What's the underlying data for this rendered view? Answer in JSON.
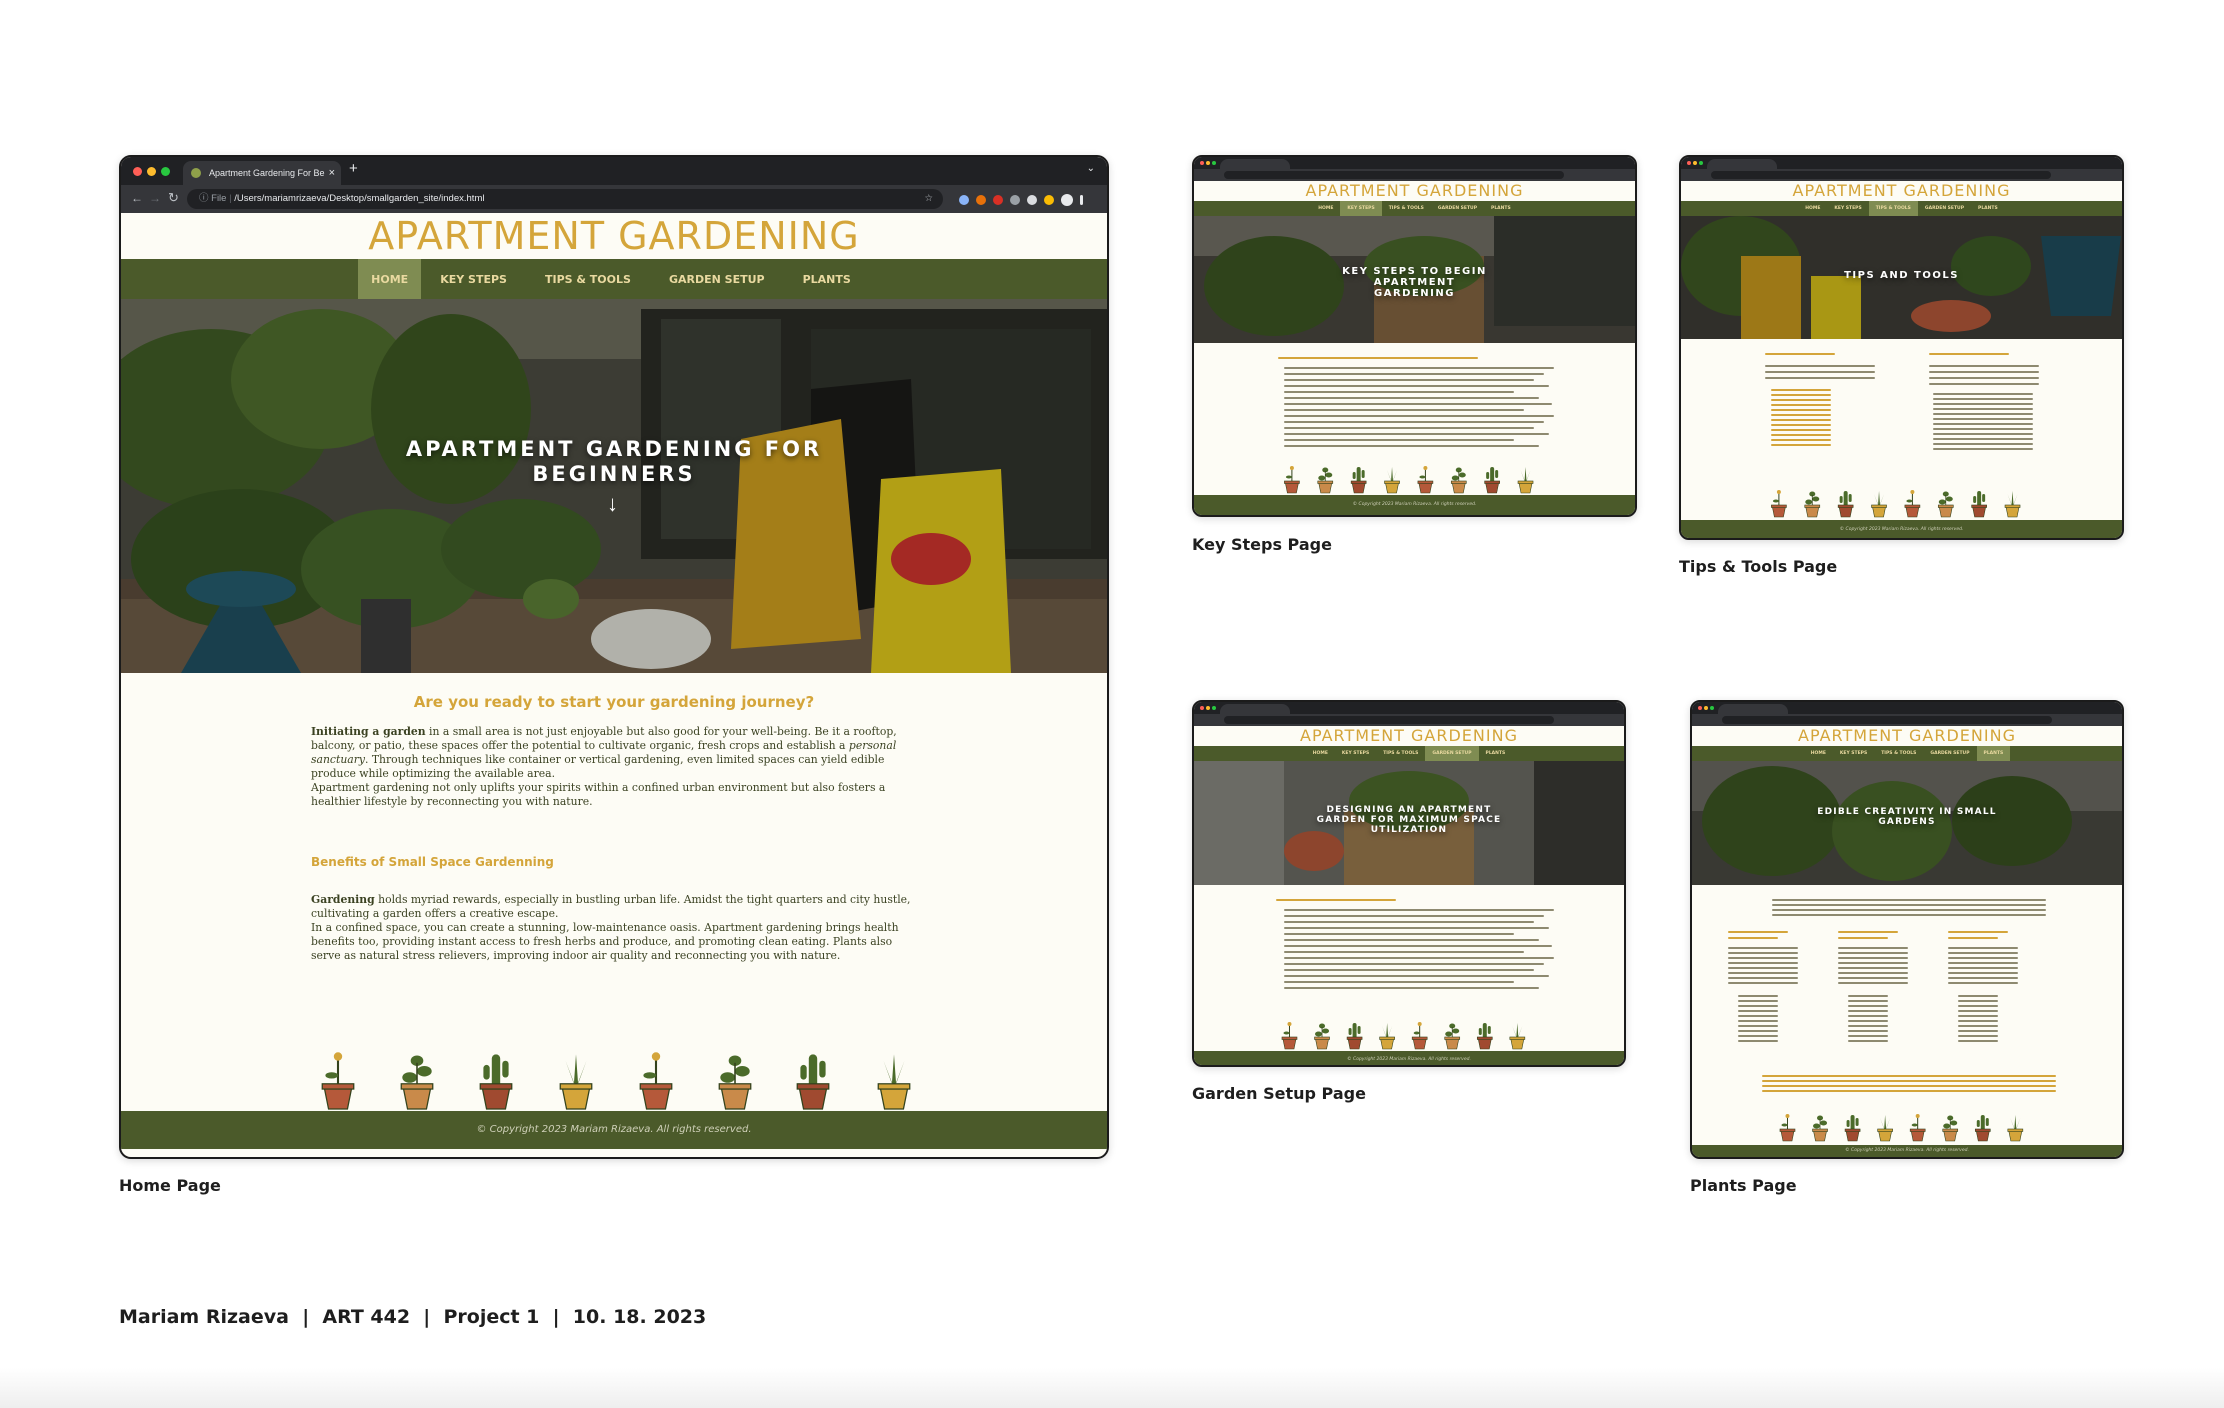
{
  "main_window": {
    "tab_title": "Apartment Gardening For Be",
    "tab_close": "×",
    "new_tab": "+",
    "url_prefix": "File",
    "url": "/Users/mariamrizaeva/Desktop/smallgarden_site/index.html",
    "site_title": "APARTMENT GARDENING",
    "nav": [
      "HOME",
      "KEY STEPS",
      "TIPS & TOOLS",
      "GARDEN SETUP",
      "PLANTS"
    ],
    "active_nav": "HOME",
    "hero_title": "APARTMENT GARDENING FOR BEGINNERS",
    "hero_arrow": "↓",
    "intro_heading": "Are you ready to start your gardening journey?",
    "intro_p1_bold": "Initiating a garden",
    "intro_p1_a": " in a small area is not just enjoyable but also good for your well-being. Be it a rooftop, balcony, or patio, these spaces offer the potential to cultivate organic, fresh crops and establish a ",
    "intro_p1_em": "personal sanctuary",
    "intro_p1_b": ". Through techniques like container or vertical gardening, even limited spaces can yield edible produce while optimizing the available area.",
    "intro_p2": "Apartment gardening not only uplifts your spirits within a confined urban environment but also fosters a healthier lifestyle by reconnecting you with nature.",
    "benefits_heading": "Benefits of Small Space Gardenning",
    "benefits_bold": "Gardening",
    "benefits_p1": " holds myriad rewards, especially in bustling urban life. Amidst the tight quarters and city hustle, cultivating a garden offers a creative escape.",
    "benefits_p2": "In a confined space, you can create a stunning, low-maintenance oasis. Apartment gardening brings health benefits too, providing instant access to fresh herbs and produce, and promoting clean eating. Plants also serve as natural stress relievers, improving indoor air quality and reconnecting you with nature.",
    "footer": "© Copyright 2023 Mariam Rizaeva. All rights reserved."
  },
  "thumbnails": {
    "key_steps": {
      "site_title": "APARTMENT GARDENING",
      "nav": [
        "HOME",
        "KEY STEPS",
        "TIPS & TOOLS",
        "GARDEN SETUP",
        "PLANTS"
      ],
      "hero_title": "KEY STEPS TO BEGIN APARTMENT GARDENING",
      "footer": "© Copyright 2023 Mariam Rizaeva. All rights reserved."
    },
    "tips_tools": {
      "site_title": "APARTMENT GARDENING",
      "nav": [
        "HOME",
        "KEY STEPS",
        "TIPS & TOOLS",
        "GARDEN SETUP",
        "PLANTS"
      ],
      "hero_title": "TIPS AND TOOLS",
      "footer": "© Copyright 2023 Mariam Rizaeva. All rights reserved."
    },
    "garden_setup": {
      "site_title": "APARTMENT GARDENING",
      "nav": [
        "HOME",
        "KEY STEPS",
        "TIPS & TOOLS",
        "GARDEN SETUP",
        "PLANTS"
      ],
      "hero_title": "DESIGNING AN APARTMENT GARDEN FOR MAXIMUM SPACE UTILIZATION",
      "footer": "© Copyright 2023 Mariam Rizaeva. All rights reserved."
    },
    "plants": {
      "site_title": "APARTMENT GARDENING",
      "nav": [
        "HOME",
        "KEY STEPS",
        "TIPS & TOOLS",
        "GARDEN SETUP",
        "PLANTS"
      ],
      "hero_title": "EDIBLE CREATIVITY IN SMALL GARDENS",
      "footer": "© Copyright 2023 Mariam Rizaeva. All rights reserved."
    }
  },
  "captions": {
    "home": "Home Page",
    "key_steps": "Key Steps Page",
    "tips_tools": "Tips & Tools Page",
    "garden_setup": "Garden Setup Page",
    "plants": "Plants Page"
  },
  "credit_line": "Mariam Rizaeva  |  ART 442  |  Project 1  |  10. 18. 2023",
  "colors": {
    "gold": "#d4a53a",
    "olive": "#4b5a2a",
    "cream": "#fdfcf5",
    "terracotta": "#b5593a"
  },
  "icons": [
    "back-arrow-icon",
    "forward-arrow-icon",
    "reload-icon",
    "info-icon",
    "star-icon",
    "down-arrow-icon",
    "potted-plant-icon"
  ]
}
